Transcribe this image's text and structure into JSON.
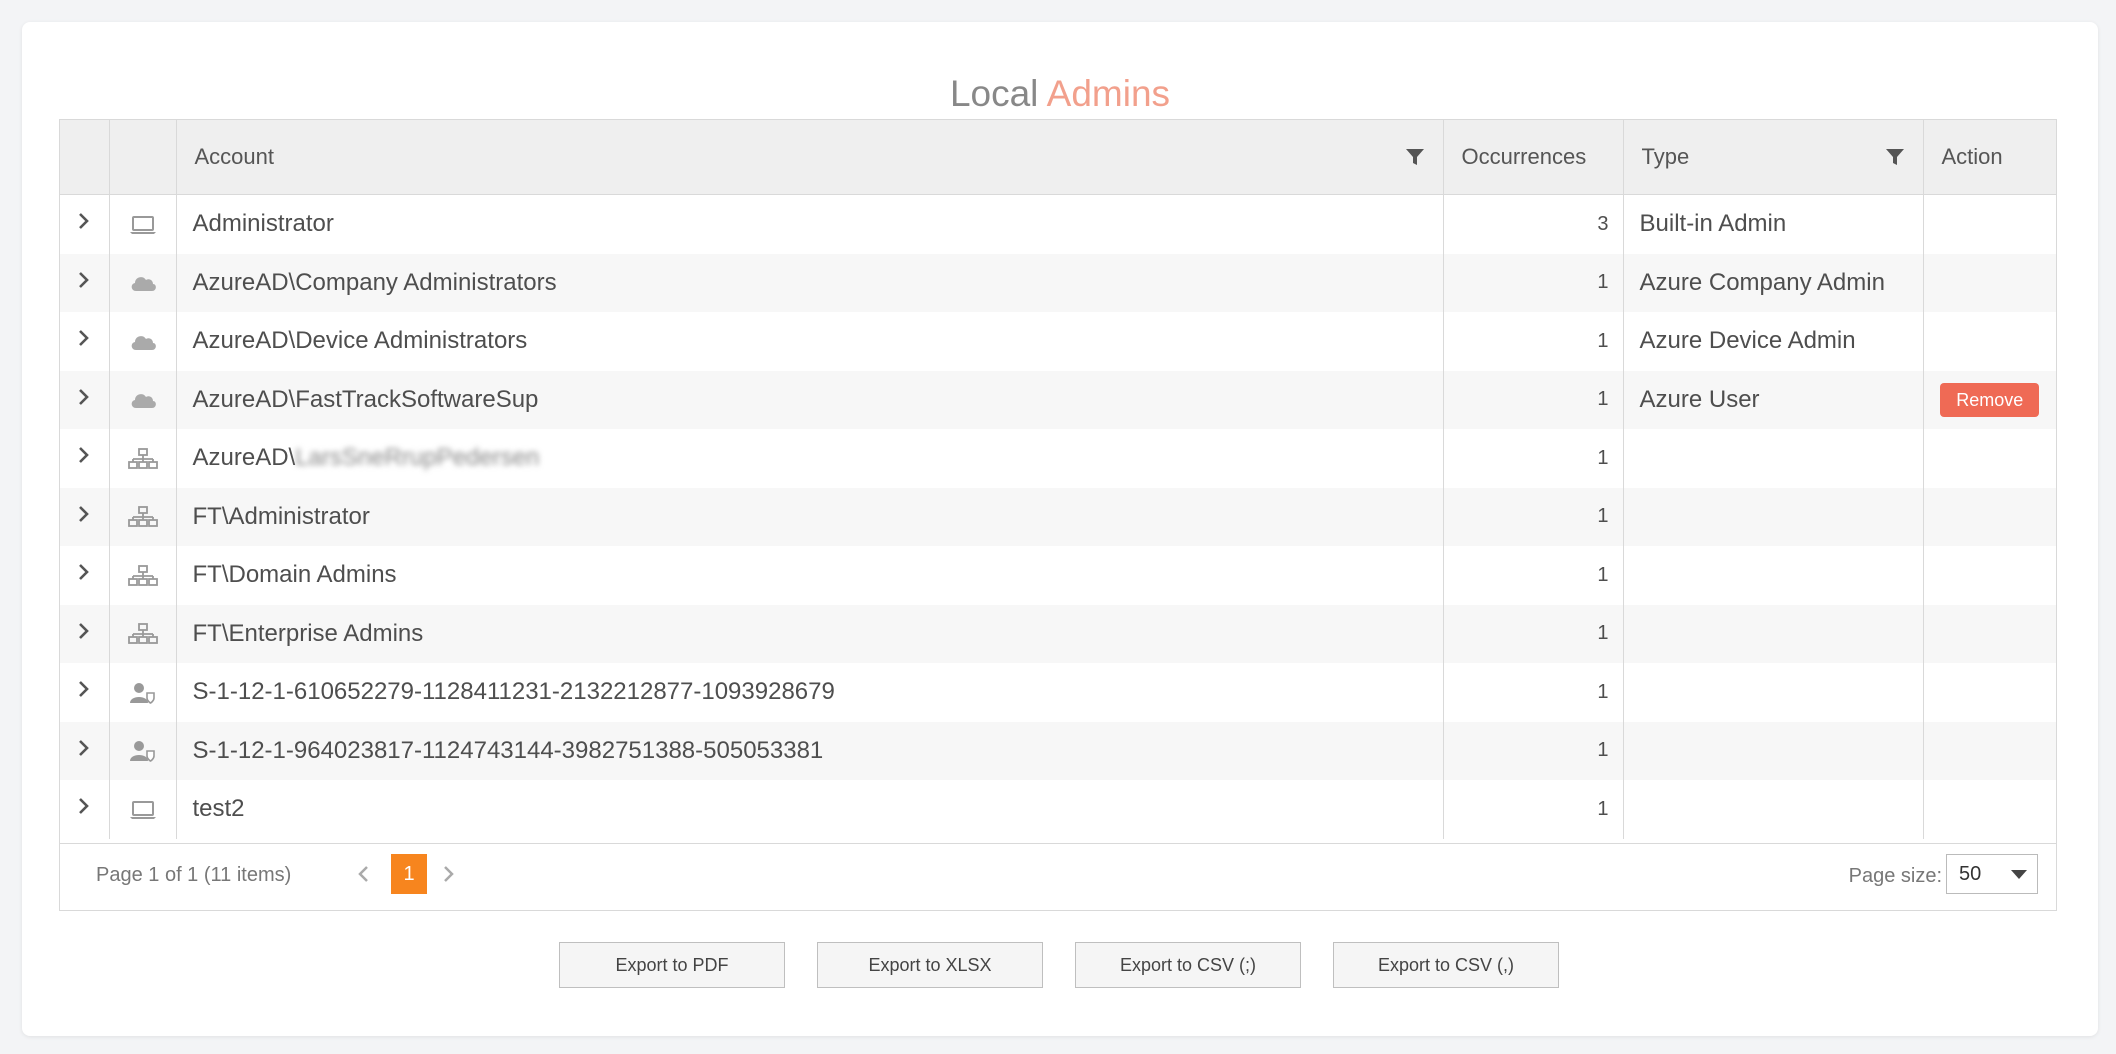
{
  "title": {
    "part1": "Local",
    "part2": "Admins"
  },
  "columns": {
    "account": "Account",
    "occurrences": "Occurrences",
    "type": "Type",
    "action": "Action"
  },
  "rows": [
    {
      "icon": "laptop-icon",
      "account": "Administrator",
      "occurrences": "3",
      "type": "Built-in Admin",
      "action": ""
    },
    {
      "icon": "cloud-icon",
      "account": "AzureAD\\Company Administrators",
      "occurrences": "1",
      "type": "Azure Company Admin",
      "action": ""
    },
    {
      "icon": "cloud-icon",
      "account": "AzureAD\\Device Administrators",
      "occurrences": "1",
      "type": "Azure Device Admin",
      "action": ""
    },
    {
      "icon": "cloud-icon",
      "account": "AzureAD\\FastTrackSoftwareSup",
      "occurrences": "1",
      "type": "Azure User",
      "action": "Remove"
    },
    {
      "icon": "network-icon",
      "account": "AzureAD\\",
      "account_blurred": "LarsSneRrupPedersen",
      "occurrences": "1",
      "type": "",
      "action": ""
    },
    {
      "icon": "network-icon",
      "account": "FT\\Administrator",
      "occurrences": "1",
      "type": "",
      "action": ""
    },
    {
      "icon": "network-icon",
      "account": "FT\\Domain Admins",
      "occurrences": "1",
      "type": "",
      "action": ""
    },
    {
      "icon": "network-icon",
      "account": "FT\\Enterprise Admins",
      "occurrences": "1",
      "type": "",
      "action": ""
    },
    {
      "icon": "user-shield-icon",
      "account": "S-1-12-1-610652279-1128411231-2132212877-1093928679",
      "occurrences": "1",
      "type": "",
      "action": ""
    },
    {
      "icon": "user-shield-icon",
      "account": "S-1-12-1-964023817-1124743144-3982751388-505053381",
      "occurrences": "1",
      "type": "",
      "action": ""
    },
    {
      "icon": "laptop-icon",
      "account": "test2",
      "occurrences": "1",
      "type": "",
      "action": ""
    }
  ],
  "pager": {
    "info": "Page 1 of 1 (11 items)",
    "current_page": "1",
    "page_size_label": "Page size:",
    "page_size_value": "50"
  },
  "exports": {
    "pdf": "Export to PDF",
    "xlsx": "Export to XLSX",
    "csv_semicolon": "Export to CSV (;)",
    "csv_comma": "Export to CSV (,)"
  },
  "colors": {
    "title_primary": "#888888",
    "title_accent": "#f2a08c",
    "remove_button": "#ef6a55",
    "current_page": "#f7851e"
  }
}
